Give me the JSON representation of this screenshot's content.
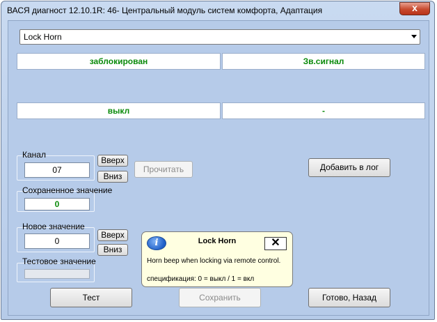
{
  "window": {
    "title": "ВАСЯ диагност 12.10.1R: 46- Центральный модуль систем комфорта, Адаптация",
    "close_glyph": "x"
  },
  "channel_select": {
    "value": "Lock Horn"
  },
  "grid": {
    "row1": [
      "заблокирован",
      "Зв.сигнал"
    ],
    "row2": [
      "выкл",
      "-"
    ]
  },
  "channel": {
    "label": "Канал",
    "value": "07",
    "up_label": "Вверх",
    "down_label": "Вниз",
    "read_label": "Прочитать"
  },
  "saved": {
    "label": "Сохраненное значение",
    "value": "0"
  },
  "new_value": {
    "label": "Новое значение",
    "value": "0",
    "up_label": "Вверх",
    "down_label": "Вниз"
  },
  "test_value": {
    "label": "Тестовое значение",
    "value": ""
  },
  "log_button": "Добавить в лог",
  "tooltip": {
    "icon": "info-icon",
    "title": "Lock Horn",
    "close_glyph": "✕",
    "text": "Horn beep when locking via remote control.",
    "spec": "спецификация: 0 = выкл / 1 = вкл"
  },
  "footer": {
    "test_label": "Тест",
    "save_label": "Сохранить",
    "done_label": "Готово, Назад"
  }
}
